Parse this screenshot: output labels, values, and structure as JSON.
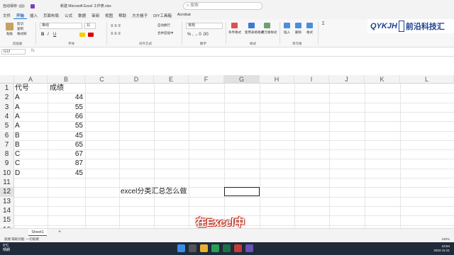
{
  "titlebar": {
    "autosave": "自动保存",
    "title": "新建 Microsoft Excel 工作表.xlsx",
    "search_placeholder": "搜索"
  },
  "menu": [
    "文件",
    "开始",
    "插入",
    "页面布局",
    "公式",
    "数据",
    "审阅",
    "视图",
    "帮助",
    "方方格子",
    "DIY工具箱",
    "Acrobat"
  ],
  "ribbon": {
    "font_name": "等线",
    "font_size": "11",
    "number_format": "常规",
    "paste": "粘贴",
    "cut": "剪切",
    "copy": "复制",
    "format_painter": "格式刷",
    "wrap": "自动换行",
    "merge": "合并后居中",
    "cond_format": "条件格式",
    "table_format": "套用表格格式",
    "cell_style": "单元格样式",
    "insert": "插入",
    "delete": "删除",
    "format": "格式",
    "groups": {
      "clipboard": "剪贴板",
      "font": "字体",
      "align": "对齐方式",
      "number": "数字",
      "styles": "样式",
      "cells": "单元格"
    }
  },
  "logo": {
    "en": "QYKJH",
    "cn": "前沿科技汇"
  },
  "formula_bar": {
    "namebox": "G12",
    "fx": "fx"
  },
  "columns": [
    "A",
    "B",
    "C",
    "D",
    "E",
    "F",
    "G",
    "H",
    "I",
    "J",
    "K",
    "L"
  ],
  "rows": [
    "1",
    "2",
    "3",
    "4",
    "5",
    "6",
    "7",
    "8",
    "9",
    "10",
    "11",
    "12",
    "13",
    "14",
    "15",
    "16"
  ],
  "table": {
    "header": [
      "代号",
      "成绩"
    ],
    "data": [
      [
        "A",
        "44"
      ],
      [
        "A",
        "55"
      ],
      [
        "A",
        "66"
      ],
      [
        "A",
        "55"
      ],
      [
        "B",
        "45"
      ],
      [
        "B",
        "65"
      ],
      [
        "C",
        "67"
      ],
      [
        "C",
        "87"
      ],
      [
        "D",
        "45"
      ]
    ]
  },
  "note": "excel分类汇总怎么做",
  "caption": "在Excel中",
  "sheet_tab": "Sheet1",
  "status": {
    "left": "就绪  辅助功能: 一切就绪",
    "zoom": "190%"
  },
  "taskbar": {
    "temp": "9°C",
    "weather": "晴朗",
    "time": "23:54",
    "date": "2024-11-21"
  }
}
